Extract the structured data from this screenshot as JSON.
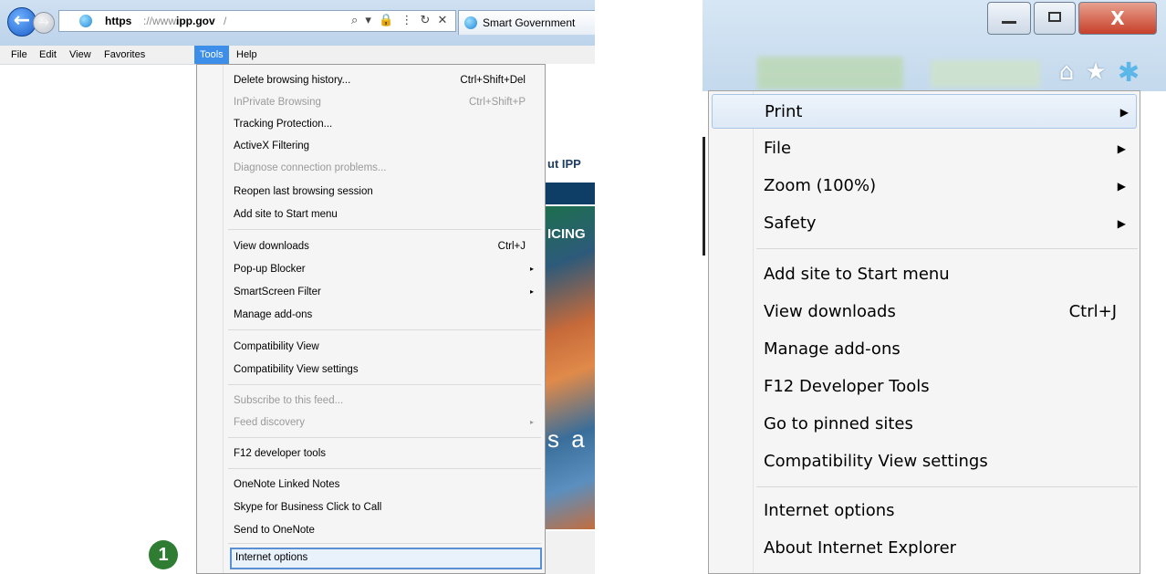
{
  "left_panel": {
    "address_bar": {
      "url_scheme": "https",
      "url_separator": "://www.",
      "url_host": "ipp.gov",
      "url_tail": "/",
      "icons": "⌕ ▾ 🔒 ⋮ ↻ ✕"
    },
    "tab": {
      "title": "Smart Government"
    },
    "menubar": {
      "file": "File",
      "edit": "Edit",
      "view": "View",
      "favorites": "Favorites",
      "tools": "Tools",
      "help": "Help"
    },
    "webpage": {
      "about_text": "ut IPP",
      "banner_text": "ICING",
      "overlay_text": "s a"
    },
    "tools_menu": {
      "items": [
        {
          "label": "Delete browsing history...",
          "shortcut": "Ctrl+Shift+Del"
        },
        {
          "label": "InPrivate Browsing",
          "shortcut": "Ctrl+Shift+P"
        },
        {
          "label": "Tracking Protection..."
        },
        {
          "label": "ActiveX Filtering"
        },
        {
          "label": "Diagnose connection problems..."
        },
        {
          "label": "Reopen last browsing session"
        },
        {
          "label": "Add site to Start menu"
        },
        {
          "label": "View downloads",
          "shortcut": "Ctrl+J"
        },
        {
          "label": "Pop-up Blocker"
        },
        {
          "label": "SmartScreen Filter"
        },
        {
          "label": "Manage add-ons"
        },
        {
          "label": "Compatibility View"
        },
        {
          "label": "Compatibility View settings"
        },
        {
          "label": "Subscribe to this feed..."
        },
        {
          "label": "Feed discovery"
        },
        {
          "label": "F12 developer tools"
        },
        {
          "label": "OneNote Linked Notes"
        },
        {
          "label": "Skype for Business Click to Call"
        },
        {
          "label": "Send to OneNote"
        },
        {
          "label": "Internet options"
        }
      ],
      "submenu_arrow": "▸"
    },
    "step_badge": "1"
  },
  "right_panel": {
    "window_buttons": {
      "close": "X"
    },
    "toolbar_icons": {
      "home": "⌂",
      "favorites": "★",
      "settings": "✱"
    },
    "settings_menu": {
      "items": [
        {
          "label": "Print"
        },
        {
          "label": "File"
        },
        {
          "label": "Zoom (100%)"
        },
        {
          "label": "Safety"
        },
        {
          "label": "Add site to Start menu"
        },
        {
          "label": "View downloads",
          "shortcut": "Ctrl+J"
        },
        {
          "label": "Manage add-ons"
        },
        {
          "label": "F12 Developer Tools"
        },
        {
          "label": "Go to pinned sites"
        },
        {
          "label": "Compatibility View settings"
        },
        {
          "label": "Internet options"
        },
        {
          "label": "About Internet Explorer"
        }
      ],
      "submenu_arrow": "▶"
    }
  }
}
